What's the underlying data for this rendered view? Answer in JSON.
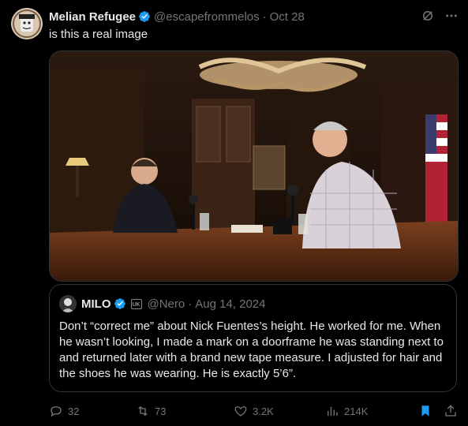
{
  "post": {
    "author_name": "Melian Refugee",
    "handle": "@escapefrommelos",
    "separator": "·",
    "date": "Oct 28",
    "text": "is this a real image"
  },
  "quote": {
    "author_name": "MILO",
    "affiliate_badge": "UK",
    "handle": "@Nero",
    "separator": "·",
    "date": "Aug 14, 2024",
    "text": "Don’t “correct me” about Nick Fuentes’s height. He worked for me. When he wasn’t looking, I made a mark on a doorframe he was standing next to and returned later with a brand new tape measure. I adjusted for hair and the shoes he was wearing. He is exactly 5’6”."
  },
  "actions": {
    "replies": "32",
    "reposts": "73",
    "likes": "3.2K",
    "views": "214K"
  },
  "icons": {
    "verified": "verified-badge-icon",
    "grok": "grok-icon",
    "more": "more-icon",
    "reply": "reply-icon",
    "repost": "repost-icon",
    "like": "heart-icon",
    "views": "views-icon",
    "bookmark": "bookmark-icon",
    "share": "share-icon"
  },
  "colors": {
    "background": "#000000",
    "text": "#e7e9ea",
    "muted": "#71767b",
    "accent": "#1d9bf0",
    "border": "#2f3336"
  }
}
